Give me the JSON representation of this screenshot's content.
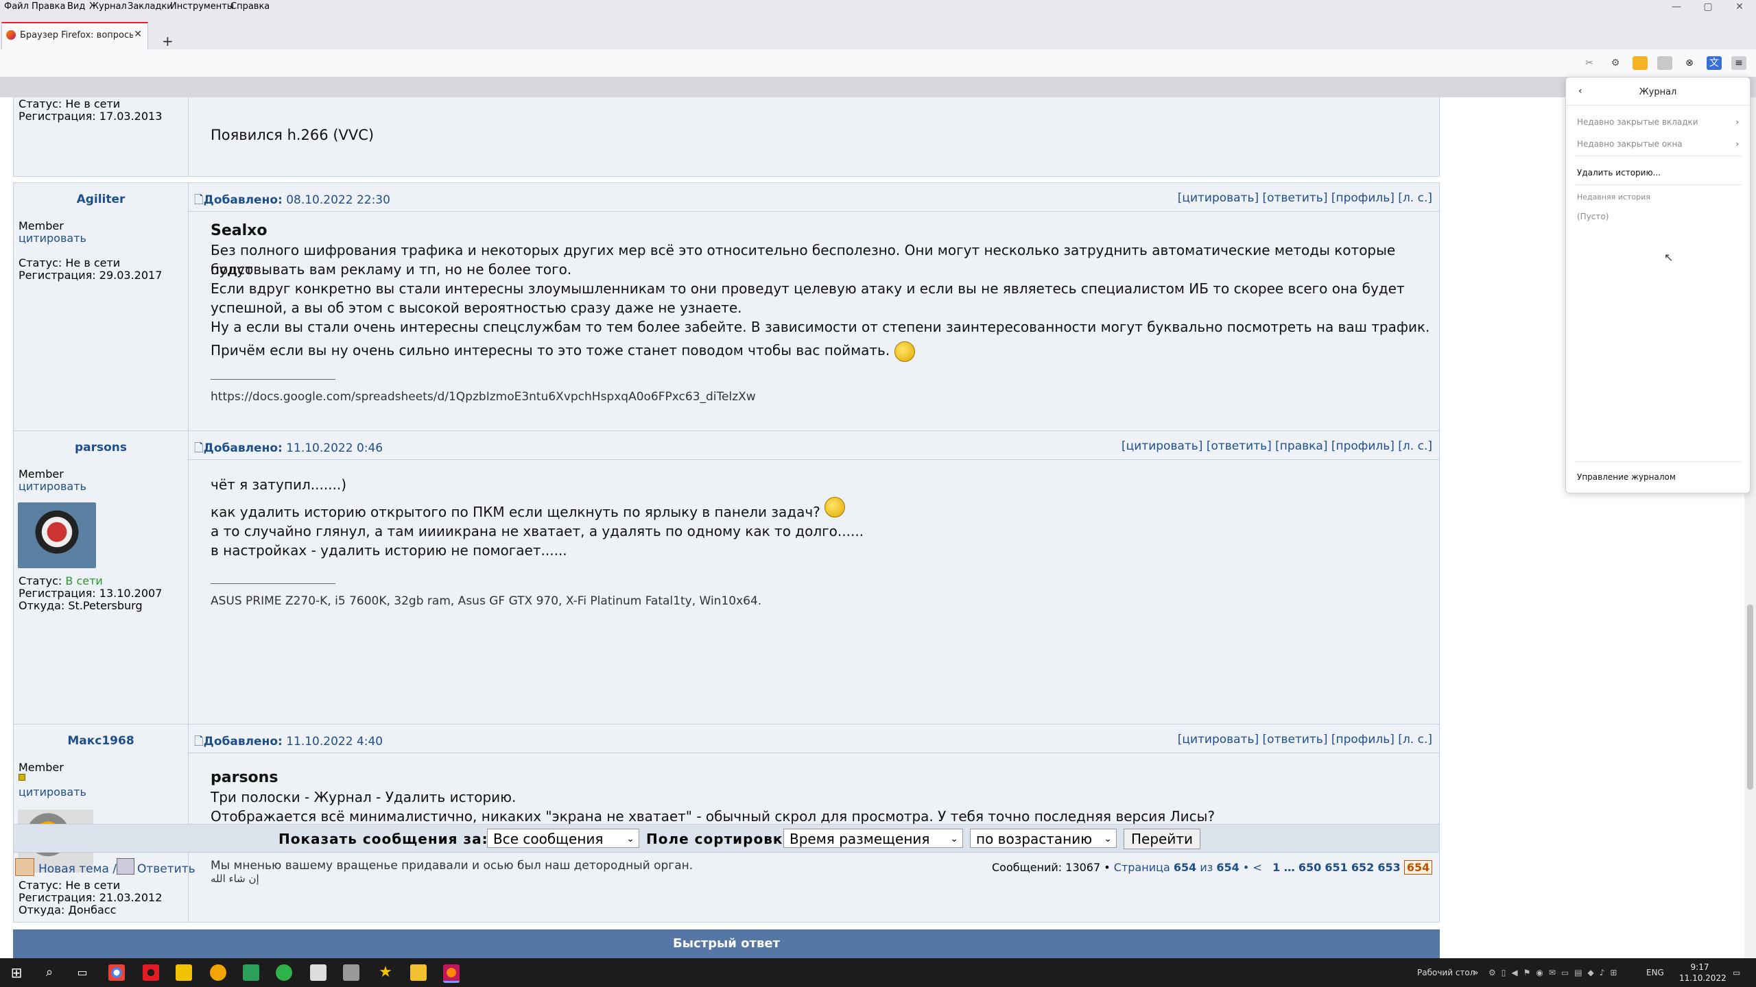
{
  "menu": [
    "Файл",
    "Правка",
    "Вид",
    "Журнал",
    "Закладки",
    "Инструменты",
    "Справка"
  ],
  "window_controls": [
    "—",
    "▢",
    "✕"
  ],
  "tab": {
    "title": "Браузер Firefox: вопросы, отв…",
    "close": "✕"
  },
  "new_tab": "+",
  "posts": [
    {
      "status_label": "Статус: Не в сети",
      "reg": "Регистрация: 17.03.2013",
      "body": [
        "Появился h.266 (VVC)"
      ]
    },
    {
      "nick": "Agiliter",
      "rank": "Member",
      "quote_link": "цитировать",
      "status_label": "Статус: Не в сети",
      "reg": "Регистрация: 29.03.2017",
      "added_label": "Добавлено:",
      "added_date": "08.10.2022 22:30",
      "actions": "[цитировать] [ответить] [профиль] [л. с.]",
      "quote_name": "Sealxo",
      "body": [
        "Без полного шифрования трафика и некоторых других мер всё это относительно бесполезно. Они могут несколько затруднить автоматические методы которые будут",
        "подсовывать вам рекламу и тп, но не более того.",
        "Если вдруг конкретно вы стали интересны злоумышленникам то они проведут целевую атаку и если вы не являетесь специалистом ИБ то скорее всего она будет",
        "успешной, а вы об этом с высокой вероятностью сразу даже не узнаете.",
        "Ну а если вы стали очень интересны спецслужбам то тем более забейте. В зависимости от степени заинтересованности могут буквально посмотреть на ваш трафик.",
        "Причём если вы ну очень сильно интересны то это тоже станет поводом чтобы вас поймать."
      ],
      "signature": "https://docs.google.com/spreadsheets/d/1QpzbIzmoE3ntu6XvpchHspxqA0o6FPxc63_diTelzXw"
    },
    {
      "nick": "parsons",
      "rank": "Member",
      "quote_link": "цитировать",
      "status_label": "Статус:",
      "status_value": "В сети",
      "reg": "Регистрация: 13.10.2007",
      "from": "Откуда: St.Petersburg",
      "added_label": "Добавлено:",
      "added_date": "11.10.2022 0:46",
      "actions": "[цитировать] [ответить] [правка] [профиль] [л. с.]",
      "body": [
        "чёт я затупил.......)",
        "как удалить историю открытого по ПКМ если щелкнуть по ярлыку в панели задач?",
        "а то случайно глянул, а там иииикрана не хватает, а удалять по одному как то долго......",
        "в настройках - удалить историю не помогает......"
      ],
      "signature": "ASUS PRIME Z270-K, i5 7600K, 32gb ram, Asus GF GTX 970, X-Fi Platinum Fatal1ty, Win10x64."
    },
    {
      "nick": "Макс1968",
      "rank": "Member",
      "quote_link": "цитировать",
      "status_label": "Статус: Не в сети",
      "reg": "Регистрация: 21.03.2012",
      "from": "Откуда: Донбасс",
      "added_label": "Добавлено:",
      "added_date": "11.10.2022 4:40",
      "actions": "[цитировать] [ответить] [профиль] [л. с.]",
      "quote_name": "parsons",
      "body": [
        "Три полоски - Журнал - Удалить историю.",
        "Отображается всё минималистично, никаких \"экрана не хватает\" - обычный скрол для просмотра. У тебя точно последняя версия Лисы?"
      ],
      "signature": "Мы мненью вашему вращенье придавали и осью был наш детородный орган.",
      "signature2": "إن شاء الله"
    }
  ],
  "sortbar": {
    "show_label": "Показать сообщения за:",
    "show_value": "Все сообщения",
    "sort_label": "Поле сортировки",
    "sort_value": "Время размещения",
    "order_value": "по возрастанию",
    "go_button": "Перейти"
  },
  "nav": {
    "new_topic": "Новая тема /",
    "reply": "Ответить",
    "messages": "Сообщений: 13067 •",
    "page_text": "Страница",
    "page_current": "654",
    "page_of": "из",
    "page_total": "654",
    "page_prev": "• <",
    "pages": [
      "1 …",
      "650",
      "651",
      "652",
      "653"
    ],
    "page_active": "654"
  },
  "quick_reply": "Быстрый ответ",
  "history_panel": {
    "title": "Журнал",
    "recent_tabs": "Недавно закрытые вкладки",
    "recent_windows": "Недавно закрытые окна",
    "clear_history": "Удалить историю...",
    "recent_history": "Недавняя история",
    "empty": "(Пусто)",
    "manage": "Управление журналом"
  },
  "taskbar": {
    "desktop_label": "Рабочий стол",
    "lang": "ENG",
    "time": "9:17",
    "date": "11.10.2022"
  }
}
